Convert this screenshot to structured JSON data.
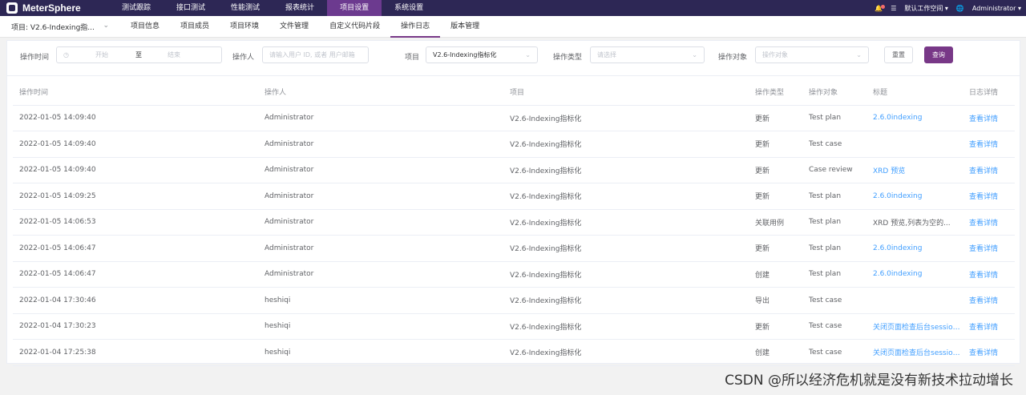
{
  "app": {
    "name": "MeterSphere"
  },
  "topnav": [
    "测试跟踪",
    "接口测试",
    "性能测试",
    "报表统计",
    "项目设置",
    "系统设置"
  ],
  "topnav_active": 4,
  "header_right": {
    "workspace": "默认工作空间",
    "user": "Administrator"
  },
  "project_select": "项目: V2.6-Indexing指...",
  "subnav": [
    "项目信息",
    "项目成员",
    "项目环境",
    "文件管理",
    "自定义代码片段",
    "操作日志",
    "版本管理"
  ],
  "subnav_active": 5,
  "filters": {
    "time_label": "操作时间",
    "start_placeholder": "开始",
    "to_label": "至",
    "end_placeholder": "结束",
    "operator_label": "操作人",
    "operator_placeholder": "请输入用户 ID, 或者 用户邮箱",
    "project_label": "项目",
    "project_value": "V2.6-Indexing指标化",
    "type_label": "操作类型",
    "type_placeholder": "请选择",
    "object_label": "操作对象",
    "object_placeholder": "操作对象",
    "reset": "重置",
    "query": "查询"
  },
  "table": {
    "headers": [
      "操作时间",
      "操作人",
      "项目",
      "操作类型",
      "操作对象",
      "标题",
      "日志详情"
    ],
    "rows": [
      [
        "2022-01-05 14:09:40",
        "Administrator",
        "V2.6-Indexing指标化",
        "更新",
        "Test plan",
        "2.6.0indexing",
        "查看详情"
      ],
      [
        "2022-01-05 14:09:40",
        "Administrator",
        "V2.6-Indexing指标化",
        "更新",
        "Test case",
        "",
        "查看详情"
      ],
      [
        "2022-01-05 14:09:40",
        "Administrator",
        "V2.6-Indexing指标化",
        "更新",
        "Case review",
        "XRD 预览",
        "查看详情"
      ],
      [
        "2022-01-05 14:09:25",
        "Administrator",
        "V2.6-Indexing指标化",
        "更新",
        "Test plan",
        "2.6.0indexing",
        "查看详情"
      ],
      [
        "2022-01-05 14:06:53",
        "Administrator",
        "V2.6-Indexing指标化",
        "关联用例",
        "Test plan",
        "XRD 预览,列表为空的...",
        "查看详情"
      ],
      [
        "2022-01-05 14:06:47",
        "Administrator",
        "V2.6-Indexing指标化",
        "更新",
        "Test plan",
        "2.6.0indexing",
        "查看详情"
      ],
      [
        "2022-01-05 14:06:47",
        "Administrator",
        "V2.6-Indexing指标化",
        "创建",
        "Test plan",
        "2.6.0indexing",
        "查看详情"
      ],
      [
        "2022-01-04 17:30:46",
        "heshiqi",
        "V2.6-Indexing指标化",
        "导出",
        "Test case",
        "",
        "查看详情"
      ],
      [
        "2022-01-04 17:30:23",
        "heshiqi",
        "V2.6-Indexing指标化",
        "更新",
        "Test case",
        "关闭页面检查后台session是",
        "查看详情"
      ],
      [
        "2022-01-04 17:25:38",
        "heshiqi",
        "V2.6-Indexing指标化",
        "创建",
        "Test case",
        "关闭页面检查后台session是",
        "查看详情"
      ]
    ],
    "title_is_link": [
      true,
      false,
      true,
      true,
      false,
      true,
      true,
      false,
      true,
      true
    ]
  },
  "watermark": "CSDN @所以经济危机就是没有新技术拉动增长",
  "colors": {
    "topbar": "#2d2755",
    "accent": "#783887",
    "link": "#409eff"
  }
}
